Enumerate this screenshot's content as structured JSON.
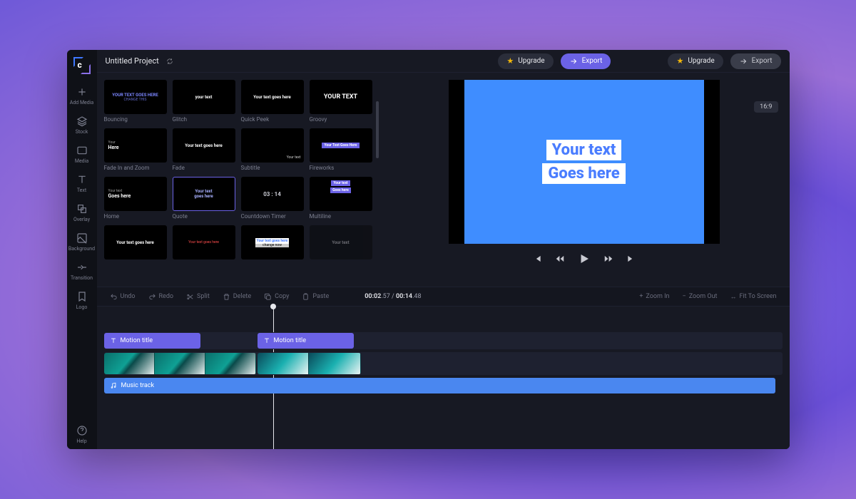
{
  "title": "Untitled Project",
  "upgrade_label": "Upgrade",
  "export_label": "Export",
  "aspect": "16:9",
  "sidebar": [
    {
      "id": "add-media",
      "label": "Add Media"
    },
    {
      "id": "stock",
      "label": "Stock"
    },
    {
      "id": "media",
      "label": "Media"
    },
    {
      "id": "text",
      "label": "Text"
    },
    {
      "id": "overlay",
      "label": "Overlay"
    },
    {
      "id": "background",
      "label": "Background"
    },
    {
      "id": "transition",
      "label": "Transition"
    },
    {
      "id": "logo",
      "label": "Logo"
    }
  ],
  "help_label": "Help",
  "library": [
    {
      "label": "Bouncing",
      "style": "blue",
      "line1": "YOUR TEXT GOES HERE",
      "line2": "CHANGE THIS"
    },
    {
      "label": "Glitch",
      "style": "plain",
      "line1": "your text"
    },
    {
      "label": "Quick Peek",
      "style": "plain",
      "line1": "Your text goes here"
    },
    {
      "label": "Groovy",
      "style": "bold",
      "line1": "YOUR TEXT"
    },
    {
      "label": "Fade In and Zoom",
      "style": "home",
      "line1": "Here",
      "tiny": "Your"
    },
    {
      "label": "Fade",
      "style": "plain",
      "line1": "Your text goes here"
    },
    {
      "label": "Subtitle",
      "style": "corner",
      "line1": "Your text"
    },
    {
      "label": "Fireworks",
      "style": "chip",
      "line1": "Your Text Goes Here"
    },
    {
      "label": "Home",
      "style": "home",
      "line1": "Goes here",
      "tiny": "Your text"
    },
    {
      "label": "Quote",
      "style": "quote",
      "line1": "Your text",
      "line2": "goes here"
    },
    {
      "label": "Countdown Timer",
      "style": "timer",
      "line1": "03 : 14"
    },
    {
      "label": "Multiline",
      "style": "multi",
      "line1": "Your text",
      "line2": "Goes here"
    },
    {
      "label": "",
      "style": "plain",
      "line1": "Your text goes here"
    },
    {
      "label": "",
      "style": "red",
      "line1": "Your text goes here"
    },
    {
      "label": "",
      "style": "white",
      "line1": "Your text goes here",
      "line2": "change now"
    },
    {
      "label": "",
      "style": "faded",
      "line1": "Your text"
    }
  ],
  "preview": {
    "line1": "Your text",
    "line2": "Goes here"
  },
  "toolbar": {
    "undo": "Undo",
    "redo": "Redo",
    "split": "Split",
    "delete": "Delete",
    "copy": "Copy",
    "paste": "Paste",
    "zoom_in": "Zoom In",
    "zoom_out": "Zoom Out",
    "fit": "Fit To Screen"
  },
  "timecode": {
    "cur": "00:02",
    "cur_f": ".57",
    "dur": "00:14",
    "dur_f": ".48"
  },
  "timeline": {
    "title_clip_label": "Motion title",
    "audio_clip_label": "Music track"
  }
}
